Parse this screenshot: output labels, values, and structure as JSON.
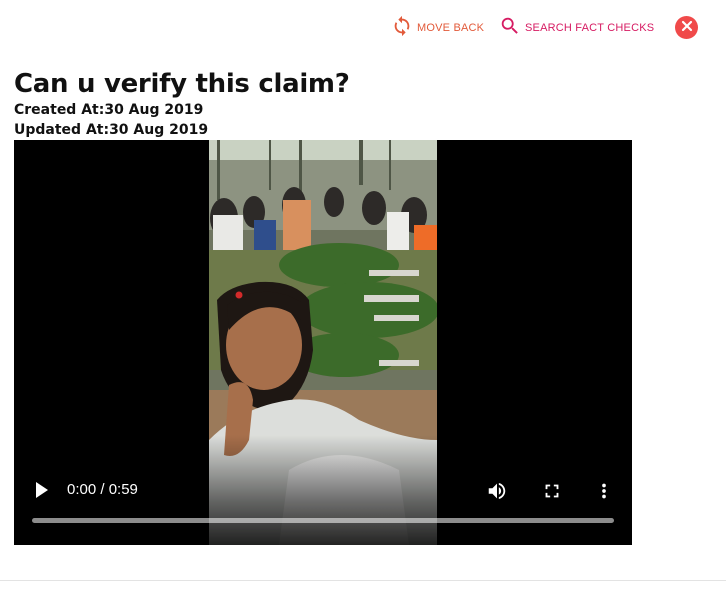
{
  "header": {
    "move_back_label": "MOVE BACK",
    "search_label": "SEARCH FACT CHECKS",
    "move_back_icon": "refresh-icon",
    "search_icon": "search-icon",
    "close_icon": "close-icon"
  },
  "post": {
    "title": "Can u verify this claim?",
    "created": "Created At:30 Aug 2019",
    "updated": "Updated At:30 Aug 2019"
  },
  "video": {
    "time": "0:00 / 0:59",
    "progress": 0,
    "play_icon": "play-icon",
    "volume_icon": "volume-icon",
    "fullscreen_icon": "fullscreen-icon",
    "more_icon": "more-vert-icon"
  },
  "colors": {
    "move_back": "#e25a3a",
    "search": "#d61b62",
    "close": "#f04a4a"
  }
}
